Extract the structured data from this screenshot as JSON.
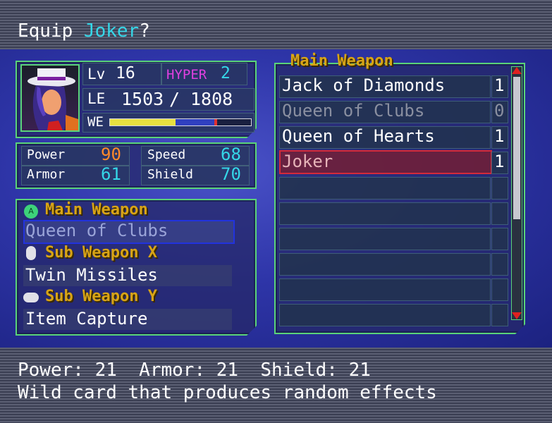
{
  "title": {
    "prefix": "Equip ",
    "name": "Joker",
    "suffix": "?"
  },
  "status": {
    "lv_label": "Lv",
    "lv_value": "16",
    "hyper_label": "HYPER",
    "hyper_value": "2",
    "le_label": "LE",
    "le_current": "1503",
    "le_sep": "/",
    "le_max": "1808",
    "we_label": "WE",
    "we_level": 0.75
  },
  "stats": {
    "power_label": "Power",
    "power_value": "90",
    "speed_label": "Speed",
    "speed_value": "68",
    "armor_label": "Armor",
    "armor_value": "61",
    "shield_label": "Shield",
    "shield_value": "70"
  },
  "equipped": {
    "main_label": "Main Weapon",
    "main_value": "Queen of Clubs",
    "main_button": "A",
    "subx_label": "Sub Weapon X",
    "subx_value": "Twin Missiles",
    "suby_label": "Sub Weapon Y",
    "suby_value": "Item Capture"
  },
  "list": {
    "header": "Main Weapon",
    "items": [
      {
        "name": "Jack of Diamonds",
        "count": "1"
      },
      {
        "name": "Queen of Clubs",
        "count": "0"
      },
      {
        "name": "Queen of Hearts",
        "count": "1"
      },
      {
        "name": "Joker",
        "count": "1"
      }
    ]
  },
  "info": {
    "stats_line": "Power: 21  Armor: 21  Shield: 21",
    "description": "Wild card that produces random effects"
  },
  "colors": {
    "accent_green": "#5ad37a",
    "gold": "#d8a416",
    "cyan": "#35d7e8",
    "orange": "#ff8a2a",
    "hyper": "#e040e0",
    "selected_red": "#d42a3a"
  }
}
